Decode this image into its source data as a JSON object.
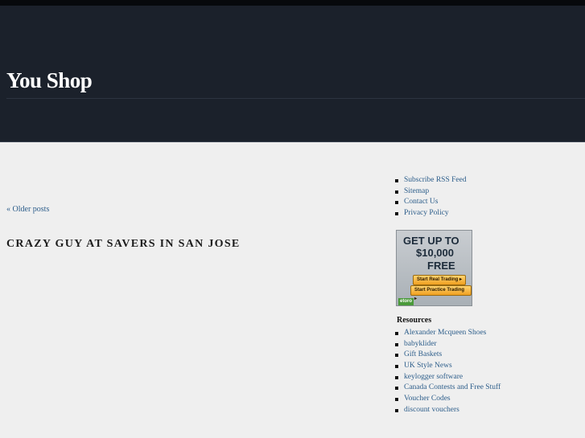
{
  "header": {
    "site_title": "You Shop"
  },
  "main": {
    "older_posts_label": "« Older posts",
    "post_title": "CRAZY GUY AT SAVERS IN SAN JOSE"
  },
  "sidebar": {
    "nav_links": [
      {
        "label": "Subscribe RSS Feed"
      },
      {
        "label": "Sitemap"
      },
      {
        "label": "Contact Us"
      },
      {
        "label": "Privacy Policy"
      }
    ],
    "ad": {
      "line1": "GET UP TO",
      "line2": "$10,000",
      "line3": "FREE",
      "button_real": "Start Real Trading ▸",
      "button_practice": "Start Practice Trading ▸",
      "logo": "etoro"
    },
    "resources_heading": "Resources",
    "resources": [
      {
        "label": "Alexander Mcqueen Shoes"
      },
      {
        "label": "babyklider"
      },
      {
        "label": "Gift Baskets"
      },
      {
        "label": "UK Style News"
      },
      {
        "label": "keylogger software"
      },
      {
        "label": "Canada Contests and Free Stuff"
      },
      {
        "label": "Voucher Codes"
      },
      {
        "label": "discount vouchers"
      }
    ]
  },
  "colors": {
    "header_bg": "#1b212b",
    "link": "#2c5d8a",
    "page_bg": "#efefef"
  }
}
